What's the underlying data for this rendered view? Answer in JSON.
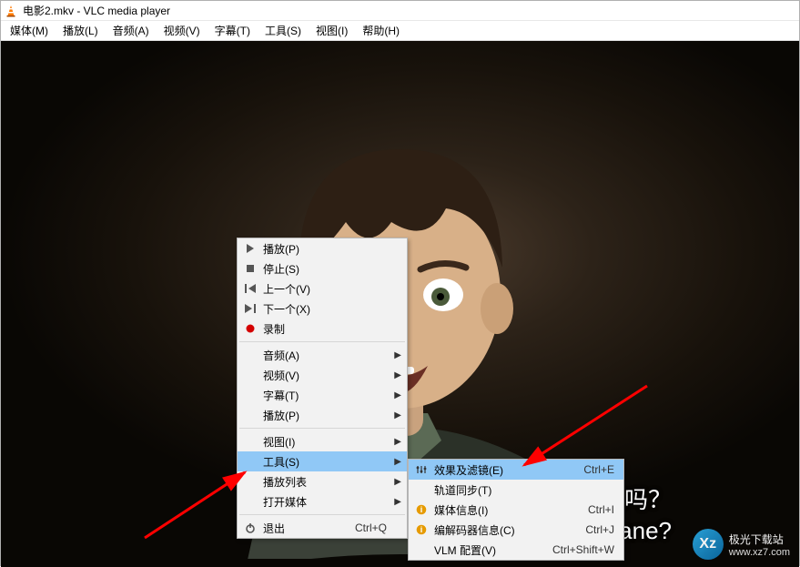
{
  "window": {
    "title": "电影2.mkv - VLC media player"
  },
  "menubar": {
    "items": [
      "媒体(M)",
      "播放(L)",
      "音频(A)",
      "视频(V)",
      "字幕(T)",
      "工具(S)",
      "视图(I)",
      "帮助(H)"
    ]
  },
  "subtitle": {
    "line1": "机吗？",
    "line2": "a plane?"
  },
  "watermark": {
    "icon_text": "Xz",
    "name": "极光下载站",
    "url": "www.xz7.com"
  },
  "context_menu": {
    "items": [
      {
        "icon": "play",
        "label": "播放(P)",
        "has_sub": false
      },
      {
        "icon": "stop",
        "label": "停止(S)",
        "has_sub": false
      },
      {
        "icon": "prev",
        "label": "上一个(V)",
        "has_sub": false
      },
      {
        "icon": "next",
        "label": "下一个(X)",
        "has_sub": false
      },
      {
        "icon": "record",
        "label": "录制",
        "has_sub": false
      },
      {
        "sep": true
      },
      {
        "icon": "",
        "label": "音频(A)",
        "has_sub": true
      },
      {
        "icon": "",
        "label": "视频(V)",
        "has_sub": true
      },
      {
        "icon": "",
        "label": "字幕(T)",
        "has_sub": true
      },
      {
        "icon": "",
        "label": "播放(P)",
        "has_sub": true
      },
      {
        "sep": true
      },
      {
        "icon": "",
        "label": "视图(I)",
        "has_sub": true
      },
      {
        "icon": "",
        "label": "工具(S)",
        "has_sub": true,
        "highlight": true
      },
      {
        "icon": "",
        "label": "播放列表",
        "has_sub": true
      },
      {
        "icon": "",
        "label": "打开媒体",
        "has_sub": true
      },
      {
        "sep": true
      },
      {
        "icon": "quit",
        "label": "退出",
        "shortcut": "Ctrl+Q",
        "has_sub": false
      }
    ]
  },
  "submenu_tools": {
    "items": [
      {
        "icon": "sliders",
        "label": "效果及滤镜(E)",
        "shortcut": "Ctrl+E",
        "highlight": true
      },
      {
        "icon": "",
        "label": "轨道同步(T)",
        "shortcut": ""
      },
      {
        "icon": "info",
        "label": "媒体信息(I)",
        "shortcut": "Ctrl+I"
      },
      {
        "icon": "info",
        "label": "编解码器信息(C)",
        "shortcut": "Ctrl+J"
      },
      {
        "icon": "",
        "label": "VLM 配置(V)",
        "shortcut": "Ctrl+Shift+W"
      }
    ]
  }
}
